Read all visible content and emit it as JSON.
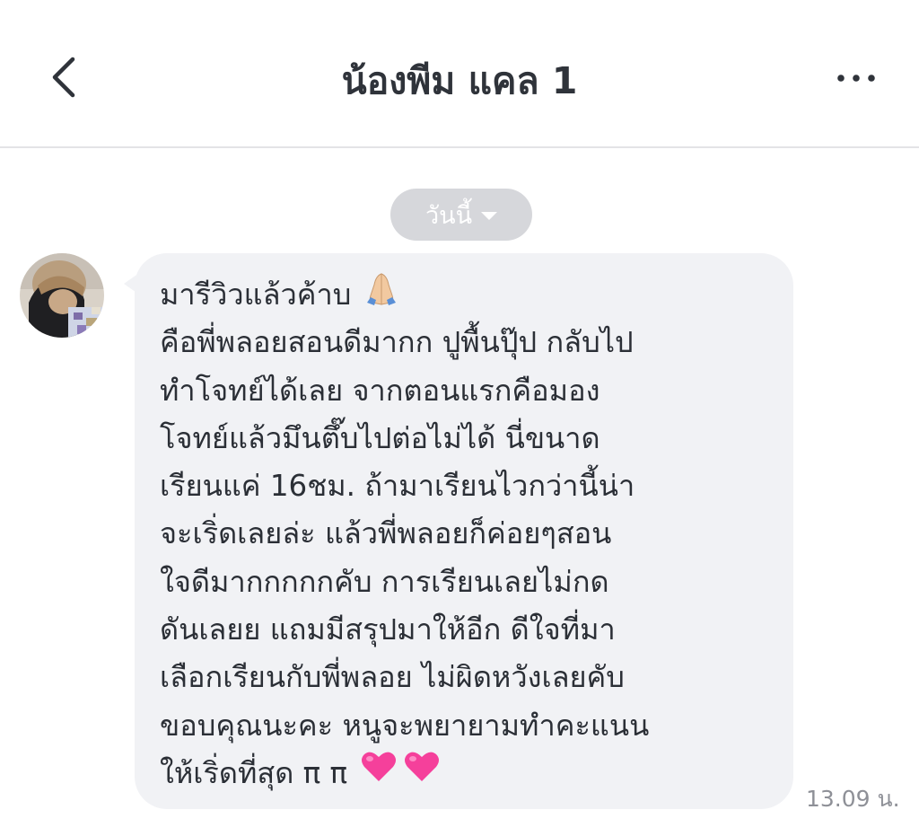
{
  "header": {
    "title": "น้องพีม แคล 1",
    "back_icon": "chevron-left-icon",
    "more_icon": "more-horizontal-icon"
  },
  "date_divider": {
    "label": "วันนี้",
    "icon": "caret-down-icon"
  },
  "message": {
    "sender_avatar": "avatar",
    "lines": [
      "มารีวิวแล้วค้าบ",
      "คือพี่พลอยสอนดีมากก ปูพื้นปุ๊ป กลับไป",
      "ทำโจทย์ได้เลย จากตอนแรกคือมอง",
      "โจทย์แล้วมึนตึ๊บไปต่อไม่ได้ นี่ขนาด",
      "เรียนแค่ 16ชม. ถ้ามาเรียนไวกว่านี้น่า",
      "จะเริ่ดเลยล่ะ แล้วพี่พลอยก็ค่อยๆสอน",
      "ใจดีมากกกกกคับ การเรียนเลยไม่กด",
      "ดันเลยย แถมมีสรุปมาให้อีก ดีใจที่มา",
      "เลือกเรียนกับพี่พลอย ไม่ผิดหวังเลยคับ",
      "ขอบคุณนะคะ หนูจะพยายามทำคะแนน",
      "ให้เริ่ดที่สุด π π"
    ],
    "emojis": {
      "first_line": "folded-hands-emoji",
      "last_line": [
        "pink-heart-emoji",
        "pink-heart-emoji"
      ]
    },
    "time": "13.09 น."
  },
  "colors": {
    "bubble": "#f1f2f5",
    "date_pill": "#d6d7db",
    "text": "#2b2f36",
    "time": "#8e9097",
    "heart": "#f5409b"
  }
}
